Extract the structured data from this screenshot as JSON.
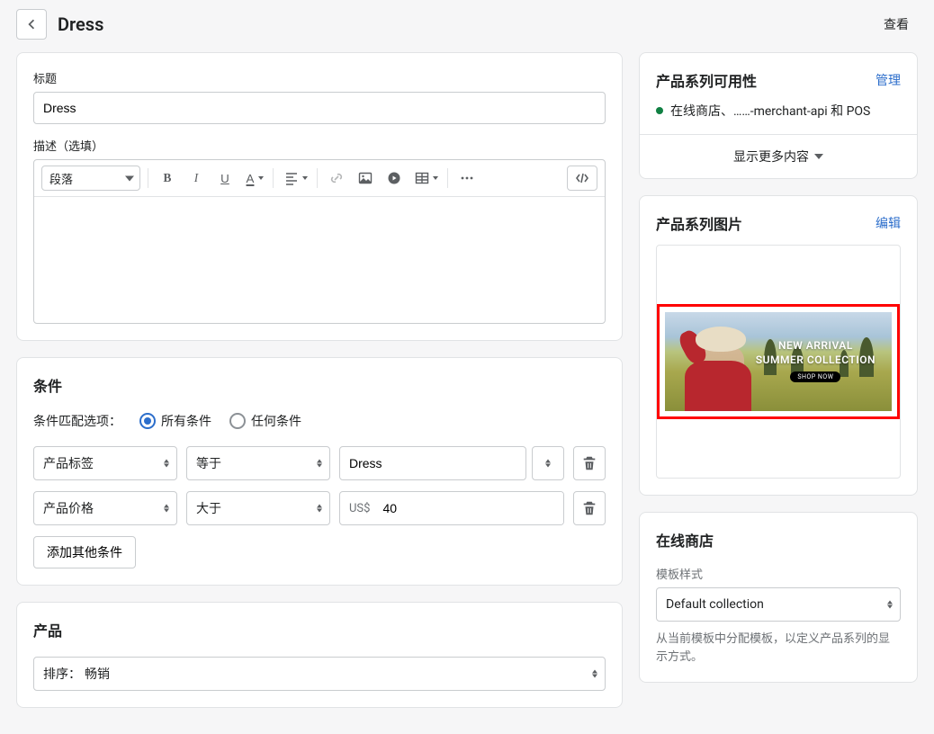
{
  "header": {
    "title": "Dress",
    "view": "查看"
  },
  "main": {
    "title_label": "标题",
    "title_value": "Dress",
    "desc_label": "描述（选填）",
    "paragraph": "段落",
    "conditions": {
      "title": "条件",
      "match_label": "条件匹配选项：",
      "all": "所有条件",
      "any": "任何条件",
      "rows": [
        {
          "field": "产品标签",
          "op": "等于",
          "value": "Dress",
          "currency": ""
        },
        {
          "field": "产品价格",
          "op": "大于",
          "value": "40",
          "currency": "US$"
        }
      ],
      "add": "添加其他条件"
    },
    "products": {
      "title": "产品",
      "sort_label": "排序：",
      "sort_value": "畅销"
    }
  },
  "sidebar": {
    "availability": {
      "title": "产品系列可用性",
      "manage": "管理",
      "status": "在线商店、……-merchant-api 和 POS",
      "show_more": "显示更多内容"
    },
    "image": {
      "title": "产品系列图片",
      "edit": "编辑",
      "banner_line1": "NEW ARRIVAL",
      "banner_line2": "SUMMER COLLECTION",
      "banner_btn": "SHOP NOW"
    },
    "online_store": {
      "title": "在线商店",
      "template_label": "模板样式",
      "template_value": "Default collection",
      "help": "从当前模板中分配模板，以定义产品系列的显示方式。"
    }
  }
}
